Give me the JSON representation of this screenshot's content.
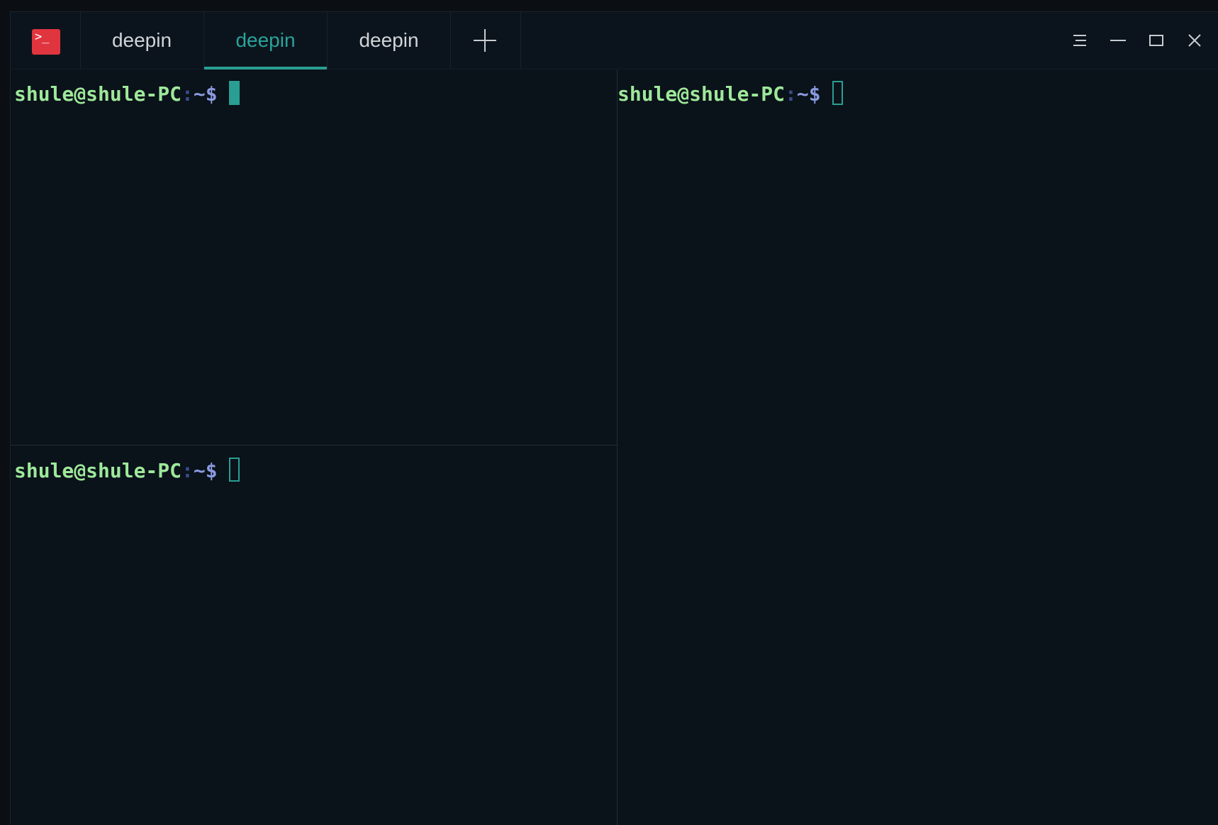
{
  "app": {
    "icon": "terminal-icon",
    "icon_glyph": ">_"
  },
  "tabs": [
    {
      "label": "deepin",
      "active": false
    },
    {
      "label": "deepin",
      "active": true
    },
    {
      "label": "deepin",
      "active": false
    }
  ],
  "toolbar": {
    "add_tab_icon": "plus-icon",
    "menu_icon": "hamburger-menu-icon",
    "minimize_icon": "minimize-icon",
    "maximize_icon": "maximize-icon",
    "close_icon": "close-icon"
  },
  "panes": [
    {
      "user_host": "shule@shule-PC",
      "sep": ":",
      "path": "~",
      "symbol": "$",
      "cursor": "solid"
    },
    {
      "user_host": "shule@shule-PC",
      "sep": ":",
      "path": "~",
      "symbol": "$",
      "cursor": "hollow"
    },
    {
      "user_host": "shule@shule-PC",
      "sep": ":",
      "path": "~",
      "symbol": "$",
      "cursor": "hollow"
    }
  ],
  "colors": {
    "background": "#0a121a",
    "accent": "#2a9e93",
    "prompt_user": "#9ee89a",
    "prompt_path": "#8a9be0",
    "app_icon": "#e0353f"
  }
}
